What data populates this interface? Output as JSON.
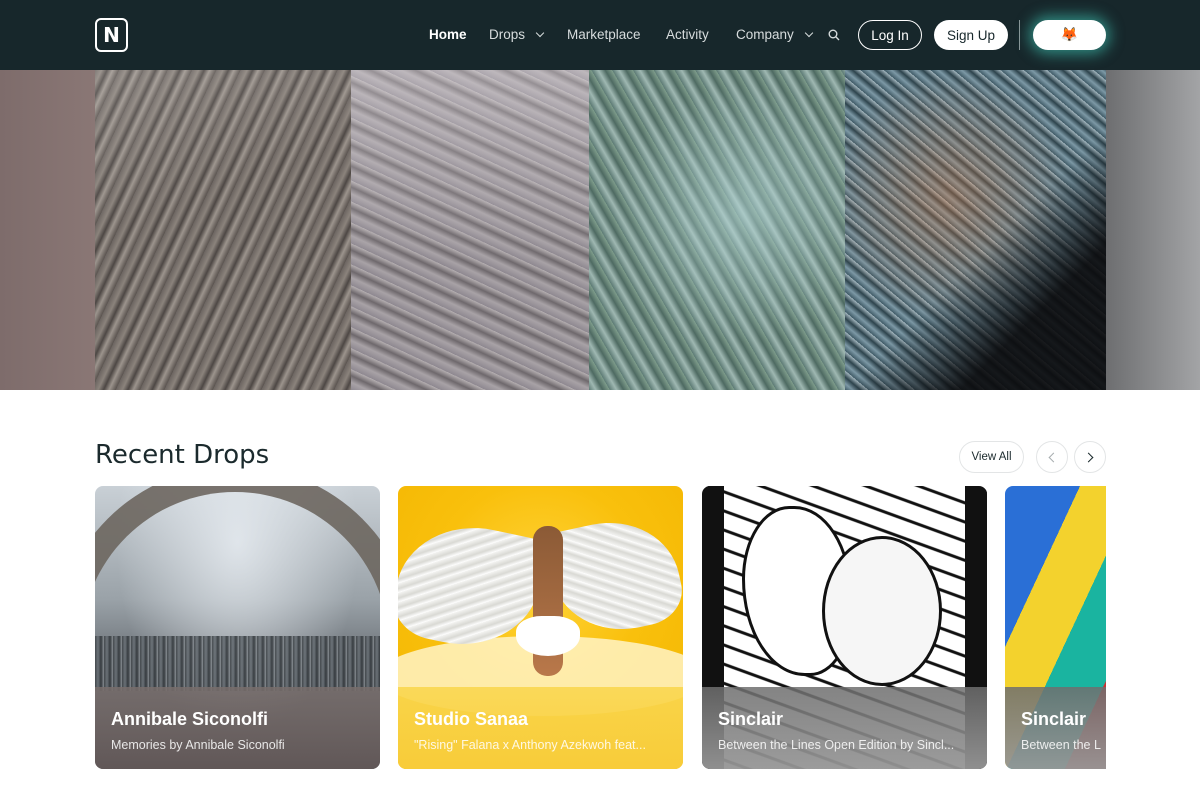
{
  "nav": {
    "logo": "N",
    "items": [
      {
        "label": "Home",
        "active": true,
        "dropdown": false
      },
      {
        "label": "Drops",
        "active": false,
        "dropdown": true
      },
      {
        "label": "Marketplace",
        "active": false,
        "dropdown": false
      },
      {
        "label": "Activity",
        "active": false,
        "dropdown": false
      },
      {
        "label": "Company",
        "active": false,
        "dropdown": true
      }
    ],
    "search_icon": "search-icon",
    "login_label": "Log In",
    "signup_label": "Sign Up",
    "wallet_icon": "🦊"
  },
  "colors": {
    "nav_bg": "#17272b",
    "wallet_glow": "#46dcc8",
    "text_dark": "#1b2a2d"
  },
  "recent_drops": {
    "title": "Recent Drops",
    "view_all_label": "View All",
    "prev_icon": "chevron-left-icon",
    "next_icon": "chevron-right-icon",
    "cards": [
      {
        "name": "Annibale Siconolfi",
        "subtitle": "Memories by Annibale Siconolfi"
      },
      {
        "name": "Studio Sanaa",
        "subtitle": "\"Rising\" Falana x Anthony Azekwoh feat..."
      },
      {
        "name": "Sinclair",
        "subtitle": "Between the Lines Open Edition by Sincl..."
      },
      {
        "name": "Sinclair",
        "subtitle": "Between the L"
      }
    ]
  }
}
